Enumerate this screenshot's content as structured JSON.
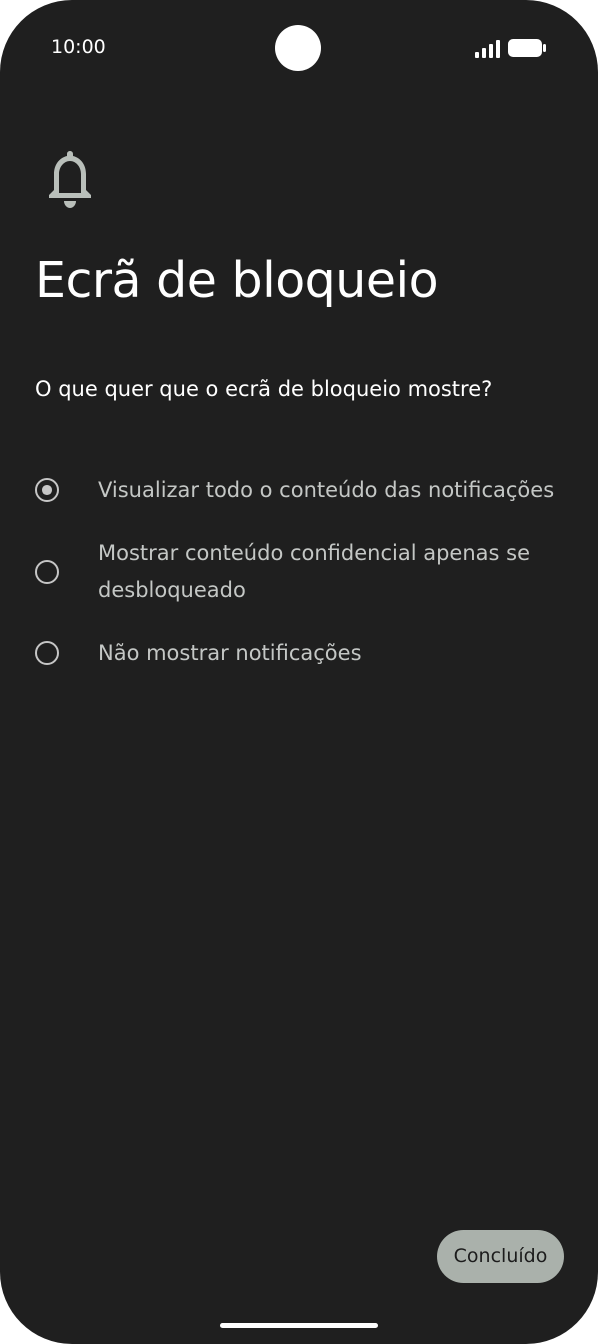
{
  "status_bar": {
    "time": "10:00",
    "signal_icon": "cellular-signal-icon",
    "battery_icon": "battery-full-icon"
  },
  "header": {
    "icon": "bell-icon",
    "title": "Ecrã de bloqueio",
    "question": "O que quer que o ecrã de bloqueio mostre?"
  },
  "options": [
    {
      "label": "Visualizar todo o conteúdo das notificações",
      "selected": true
    },
    {
      "label": "Mostrar conteúdo confidencial apenas se desbloqueado",
      "selected": false
    },
    {
      "label": "Não mostrar notificações",
      "selected": false
    }
  ],
  "footer": {
    "done_label": "Concluído"
  },
  "colors": {
    "background": "#1f1f1f",
    "title": "#ffffff",
    "option_text": "#c4c7c5",
    "radio": "#c6c6c6",
    "button_bg": "#aab1ab",
    "button_text": "#1c1c1c"
  }
}
